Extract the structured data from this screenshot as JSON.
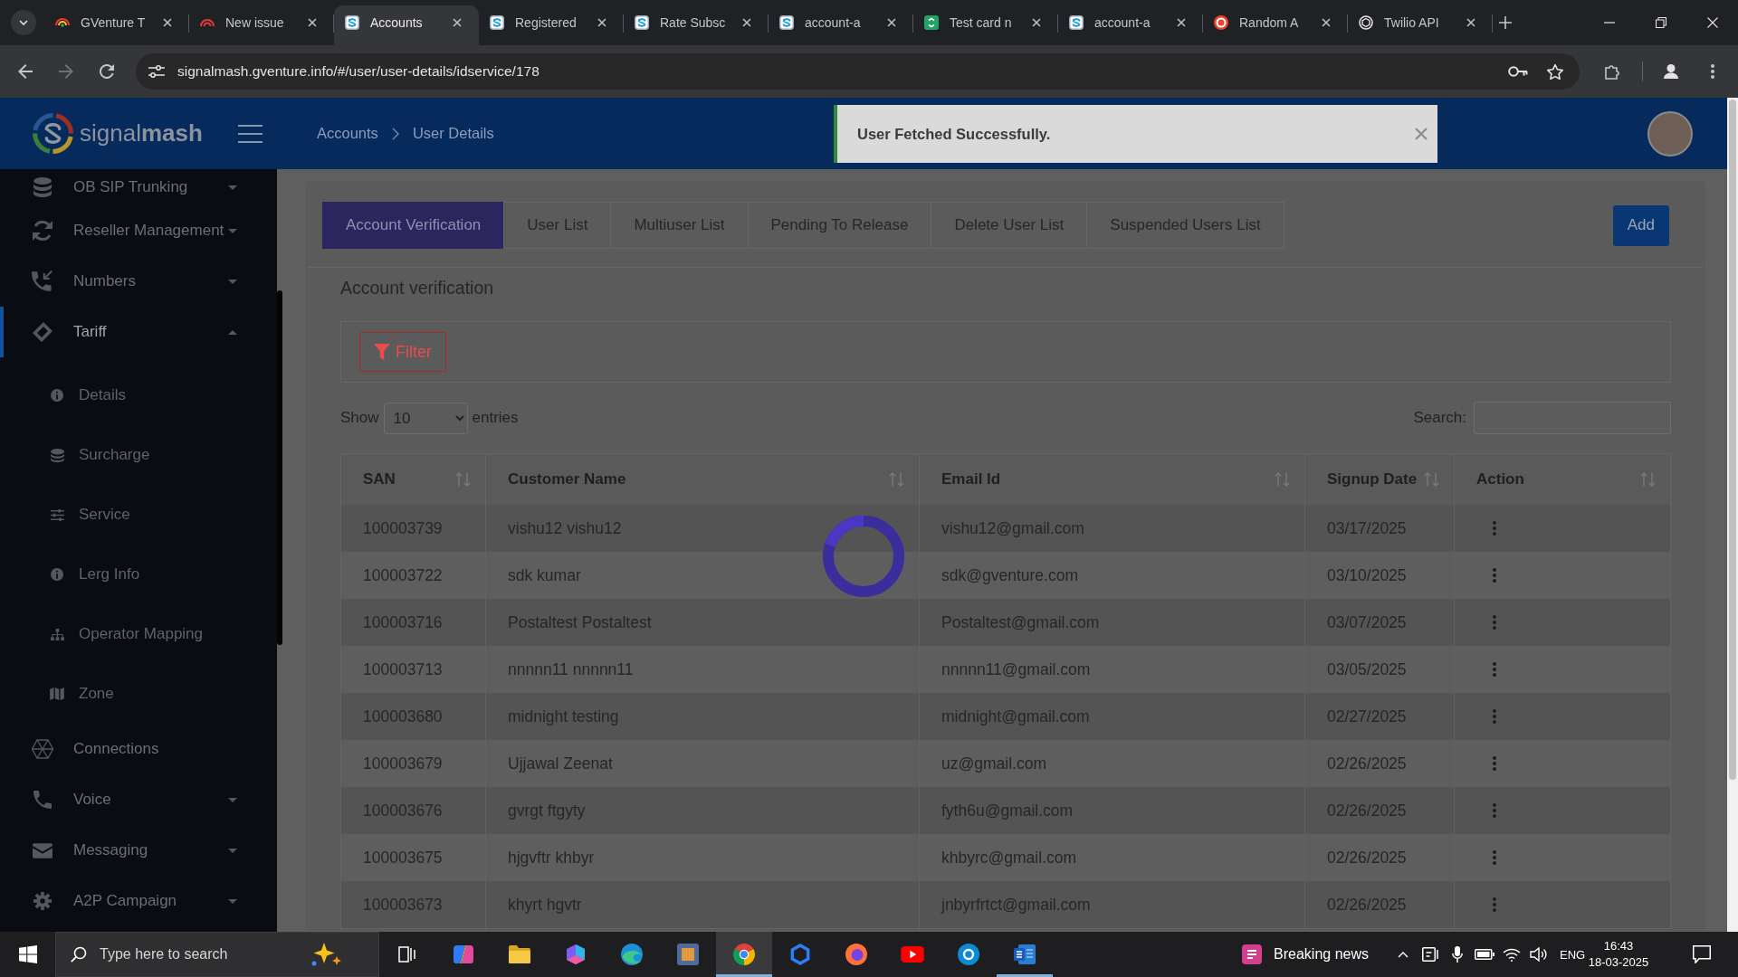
{
  "browser": {
    "tabs": [
      {
        "title": "GVenture T",
        "selected": false
      },
      {
        "title": "New issue",
        "selected": false
      },
      {
        "title": "Accounts",
        "selected": true
      },
      {
        "title": "Registered",
        "selected": false
      },
      {
        "title": "Rate Subsc",
        "selected": false
      },
      {
        "title": "account-a",
        "selected": false
      },
      {
        "title": "Test card n",
        "selected": false
      },
      {
        "title": "account-a",
        "selected": false
      },
      {
        "title": "Random A",
        "selected": false
      },
      {
        "title": "Twilio API",
        "selected": false
      }
    ],
    "forward_button": {
      "disabled": true
    },
    "url": "signalmash.gventure.info/#/user/user-details/idservice/178"
  },
  "header": {
    "logo": "signal**mash**",
    "breadcrumb": [
      "Accounts",
      "User Details"
    ],
    "toast": {
      "message": "User Fetched Successfully."
    }
  },
  "sidebar": {
    "items": [
      {
        "label": "OB SIP Trunking",
        "kind": "menu",
        "expanded": false,
        "selected": false
      },
      {
        "label": "Reseller Management",
        "kind": "menu",
        "expanded": false,
        "selected": false
      },
      {
        "label": "Numbers",
        "kind": "menu",
        "expanded": false,
        "selected": false
      },
      {
        "label": "Tariff",
        "kind": "menu",
        "expanded": true,
        "selected": true,
        "children": [
          {
            "label": "Details",
            "selected": false
          },
          {
            "label": "Surcharge",
            "selected": false
          },
          {
            "label": "Service",
            "selected": false
          },
          {
            "label": "Lerg Info",
            "selected": false
          },
          {
            "label": "Operator Mapping",
            "selected": false
          },
          {
            "label": "Zone",
            "selected": false
          }
        ]
      },
      {
        "label": "Connections",
        "kind": "link",
        "selected": false
      },
      {
        "label": "Voice",
        "kind": "menu",
        "expanded": false,
        "selected": false
      },
      {
        "label": "Messaging",
        "kind": "menu",
        "expanded": false,
        "selected": false
      },
      {
        "label": "A2P Campaign",
        "kind": "menu",
        "expanded": false,
        "selected": false
      }
    ]
  },
  "page": {
    "tabs": [
      {
        "label": "Account Verification",
        "selected": true
      },
      {
        "label": "User List",
        "selected": false
      },
      {
        "label": "Multiuser List",
        "selected": false
      },
      {
        "label": "Pending To Release",
        "selected": false
      },
      {
        "label": "Delete User List",
        "selected": false
      },
      {
        "label": "Suspended Users List",
        "selected": false
      }
    ],
    "add_button": "Add",
    "section_title": "Account verification",
    "filter_button": "Filter",
    "length_menu": {
      "label_before": "Show",
      "value": "10",
      "label_after": "entries"
    },
    "search": {
      "label": "Search:"
    },
    "table": {
      "columns": [
        "SAN",
        "Customer Name",
        "Email Id",
        "Signup Date",
        "Action"
      ],
      "rows": [
        [
          "100003739",
          "vishu12 vishu12",
          "vishu12@gmail.com",
          "03/17/2025"
        ],
        [
          "100003722",
          "sdk kumar",
          "sdk@gventure.com",
          "03/10/2025"
        ],
        [
          "100003716",
          "Postaltest Postaltest",
          "Postaltest@gmail.com",
          "03/07/2025"
        ],
        [
          "100003713",
          "nnnnn11 nnnnn11",
          "nnnnn11@gmail.com",
          "03/05/2025"
        ],
        [
          "100003680",
          "midnight testing",
          "midnight@gmail.com",
          "02/27/2025"
        ],
        [
          "100003679",
          "Ujjawal Zeenat",
          "uz@gmail.com",
          "02/26/2025"
        ],
        [
          "100003676",
          "gvrgt ftgyty",
          "fyth6u@gmail.com",
          "02/26/2025"
        ],
        [
          "100003675",
          "hjgvftr khbyr",
          "khbyrc@gmail.com",
          "02/26/2025"
        ],
        [
          "100003673",
          "khyrt hgvtr",
          "jnbyrfrtct@gmail.com",
          "02/26/2025"
        ]
      ],
      "loading": true
    }
  },
  "taskbar": {
    "search": {
      "placeholder": "Type here to search"
    },
    "apps": [
      {
        "kind": "taskview",
        "running": false,
        "selected": false
      },
      {
        "kind": "copilot",
        "running": false,
        "selected": false
      },
      {
        "kind": "folder",
        "running": false,
        "selected": false
      },
      {
        "kind": "suite",
        "running": false,
        "selected": false
      },
      {
        "kind": "edge",
        "running": false,
        "selected": false
      },
      {
        "kind": "frame",
        "running": false,
        "selected": false
      },
      {
        "kind": "chrome",
        "running": true,
        "selected": true
      },
      {
        "kind": "hexagon",
        "running": false,
        "selected": false
      },
      {
        "kind": "firefox",
        "running": false,
        "selected": false
      },
      {
        "kind": "video",
        "running": false,
        "selected": false
      },
      {
        "kind": "skype",
        "running": false,
        "selected": false
      },
      {
        "kind": "word",
        "running": true,
        "selected": false
      }
    ],
    "news": "Breaking news",
    "language": "ENG",
    "time": "16:43",
    "date": "18-03-2025"
  }
}
